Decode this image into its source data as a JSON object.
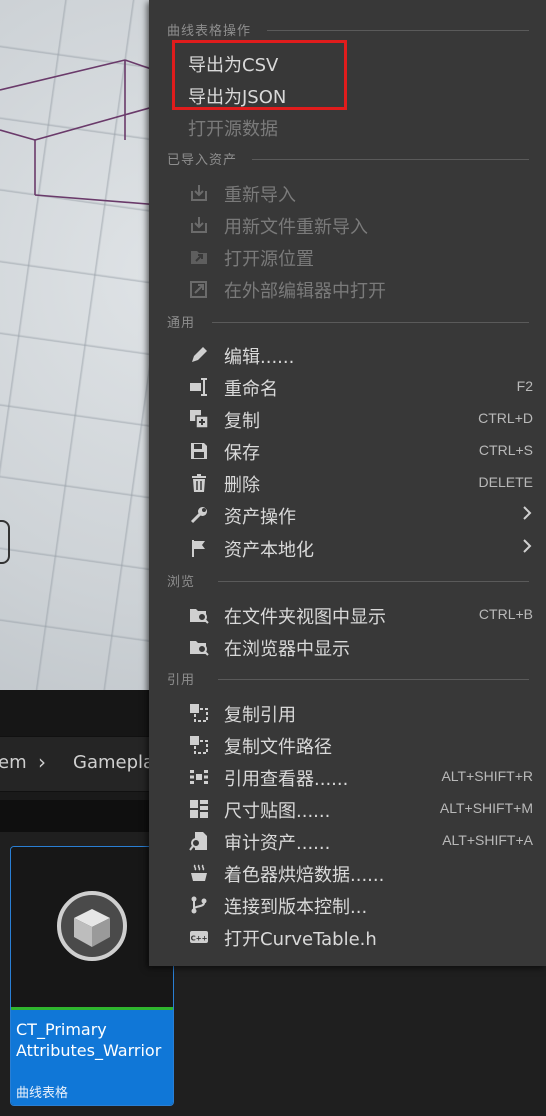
{
  "breadcrumb": {
    "item1": "em",
    "item2": "Gameplay"
  },
  "asset": {
    "name": "CT_Primary Attributes_Warrior",
    "type": "曲线表格"
  },
  "menu": {
    "sections": {
      "curve_table": "曲线表格操作",
      "imported": "已导入资产",
      "common": "通用",
      "browse": "浏览",
      "reference": "引用"
    },
    "items": {
      "export_csv": "导出为CSV",
      "export_json": "导出为JSON",
      "open_source_data": "打开源数据",
      "reimport": "重新导入",
      "reimport_new_file": "用新文件重新导入",
      "open_source_location": "打开源位置",
      "open_external_editor": "在外部编辑器中打开",
      "edit": "编辑......",
      "rename": "重命名",
      "rename_shortcut": "F2",
      "duplicate": "复制",
      "duplicate_shortcut": "CTRL+D",
      "save": "保存",
      "save_shortcut": "CTRL+S",
      "delete": "删除",
      "delete_shortcut": "DELETE",
      "asset_actions": "资产操作",
      "asset_localization": "资产本地化",
      "show_in_folder_view": "在文件夹视图中显示",
      "show_in_folder_view_shortcut": "CTRL+B",
      "show_in_explorer": "在浏览器中显示",
      "copy_reference": "复制引用",
      "copy_file_path": "复制文件路径",
      "reference_viewer": "引用查看器......",
      "reference_viewer_shortcut": "ALT+SHIFT+R",
      "size_map": "尺寸贴图......",
      "size_map_shortcut": "ALT+SHIFT+M",
      "audit_assets": "审计资产......",
      "audit_assets_shortcut": "ALT+SHIFT+A",
      "shader_bake": "着色器烘焙数据......",
      "connect_source_control": "连接到版本控制...",
      "open_header": "打开CurveTable.h"
    }
  },
  "colors": {
    "accent": "#1077d7",
    "highlight_box": "#e01c1c",
    "menu_bg": "#383838"
  }
}
